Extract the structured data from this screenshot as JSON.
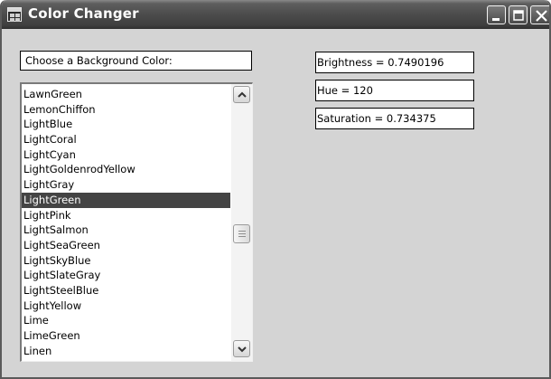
{
  "window": {
    "title": "Color Changer"
  },
  "labels": {
    "choose": "Choose a Background Color:",
    "brightness": "Brightness = 0.7490196",
    "hue": "Hue = 120",
    "saturation": "Saturation = 0.734375"
  },
  "color_list": {
    "selected": "LightGreen",
    "items": [
      "LawnGreen",
      "LemonChiffon",
      "LightBlue",
      "LightCoral",
      "LightCyan",
      "LightGoldenrodYellow",
      "LightGray",
      "LightGreen",
      "LightPink",
      "LightSalmon",
      "LightSeaGreen",
      "LightSkyBlue",
      "LightSlateGray",
      "LightSteelBlue",
      "LightYellow",
      "Lime",
      "LimeGreen",
      "Linen"
    ]
  },
  "icons": {
    "app": "window-app-icon",
    "minimize": "minimize-icon",
    "maximize": "maximize-icon",
    "close": "close-icon",
    "scroll_up": "chevron-up-icon",
    "scroll_down": "chevron-down-icon"
  },
  "colors": {
    "client_background": "#d4d4d4",
    "titlebar": "#4c4c4c",
    "selection": "#444444"
  }
}
